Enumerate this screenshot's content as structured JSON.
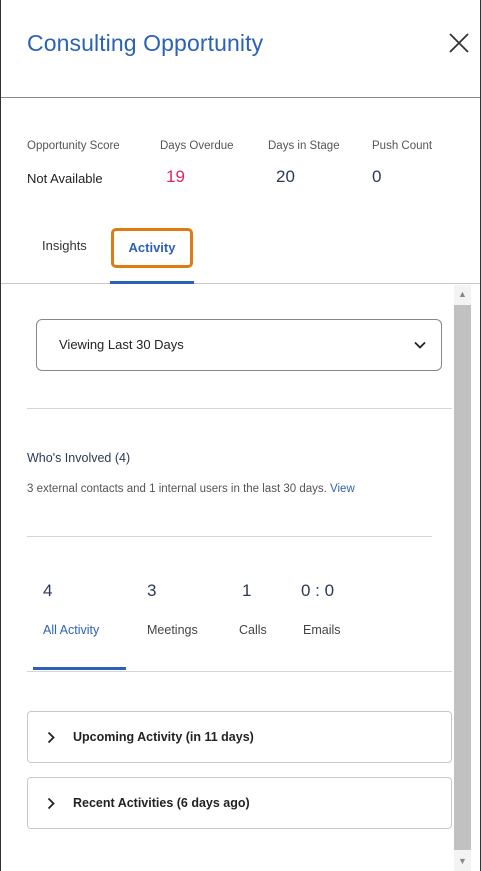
{
  "header": {
    "title": "Consulting Opportunity"
  },
  "metrics": [
    {
      "label": "Opportunity Score",
      "value": "Not Available"
    },
    {
      "label": "Days Overdue",
      "value": "19"
    },
    {
      "label": "Days in Stage",
      "value": "20"
    },
    {
      "label": "Push Count",
      "value": "0"
    }
  ],
  "tabs": {
    "insights": "Insights",
    "activity": "Activity",
    "active": "Activity"
  },
  "filter": {
    "selected": "Viewing Last 30 Days"
  },
  "involved": {
    "title": "Who's Involved (4)",
    "description": "3 external contacts and 1 internal users in the last 30 days.",
    "link": "View"
  },
  "stats": [
    {
      "value": "4",
      "label": "All Activity"
    },
    {
      "value": "3",
      "label": "Meetings"
    },
    {
      "value": "1",
      "label": "Calls"
    },
    {
      "value": "0 : 0",
      "label": "Emails"
    }
  ],
  "sections": [
    {
      "label": "Upcoming Activity (in 11 days)"
    },
    {
      "label": "Recent Activities (6 days ago)"
    }
  ],
  "colors": {
    "accent": "#2b62b8",
    "overdue": "#e0246b",
    "highlight": "#e07b12"
  }
}
